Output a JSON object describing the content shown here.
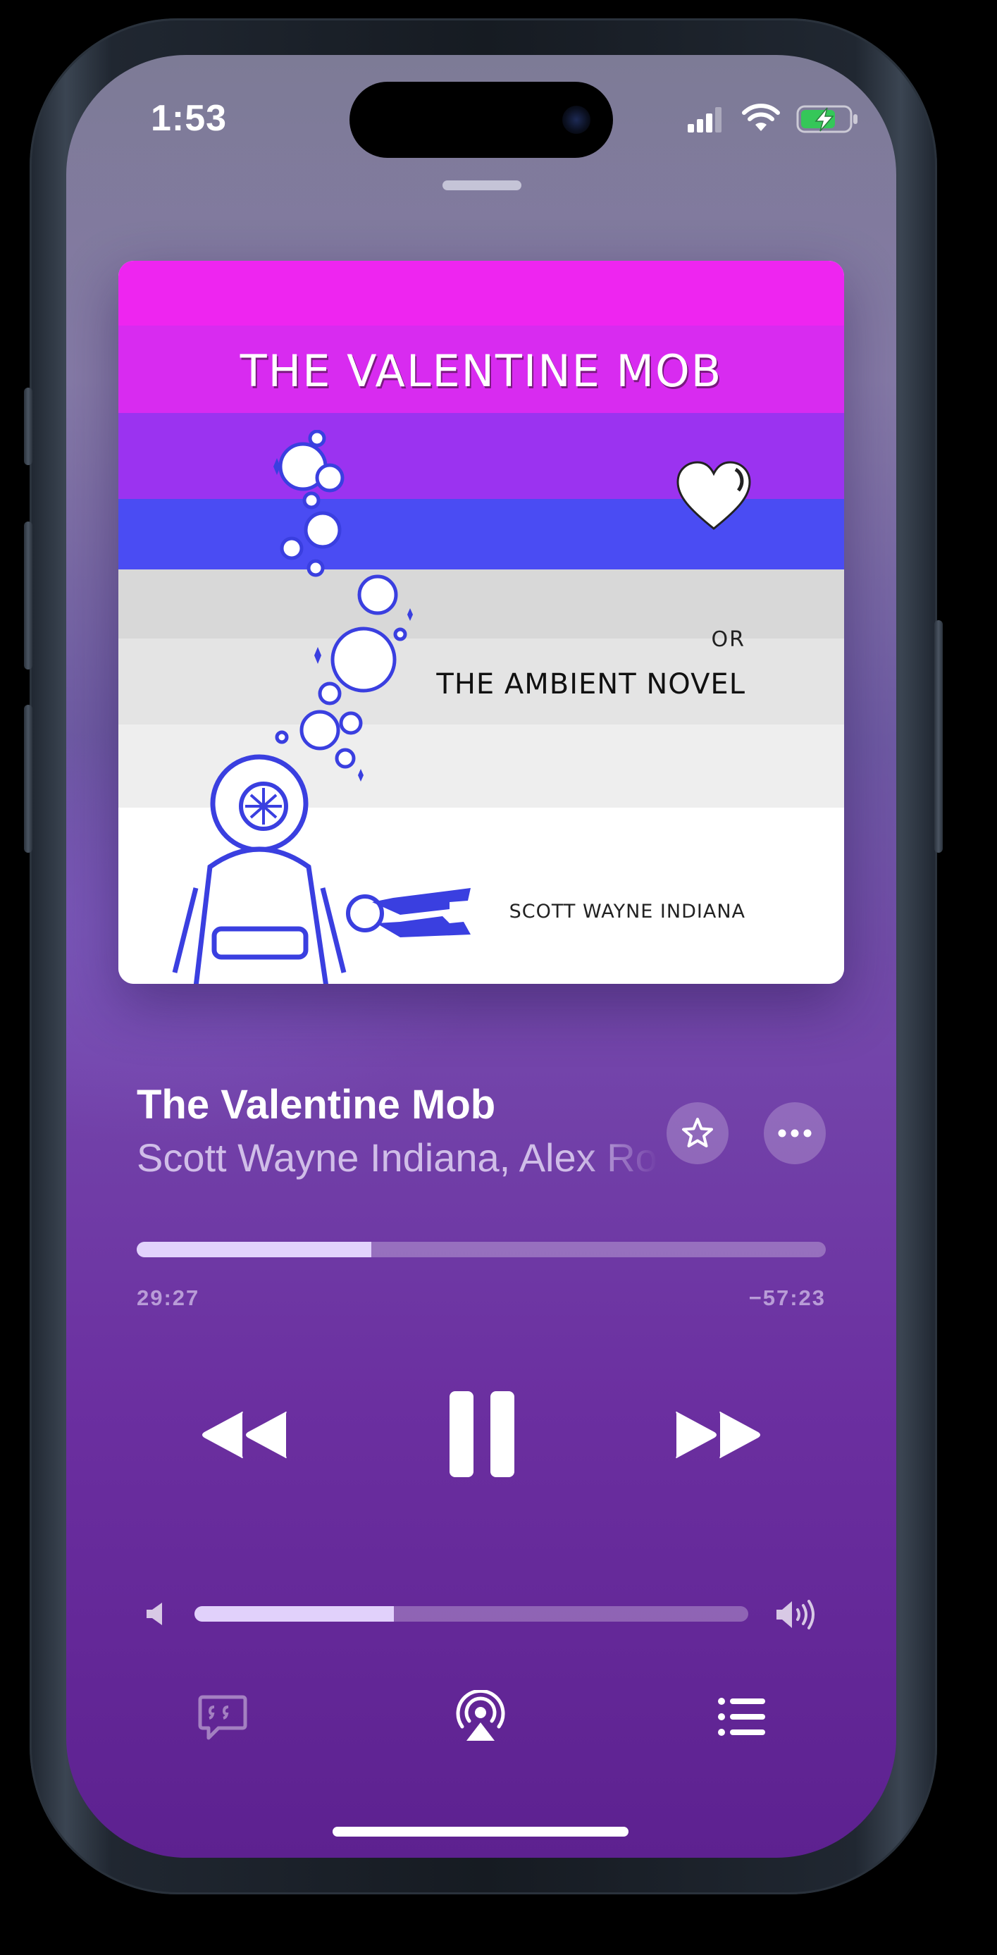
{
  "status_bar": {
    "time": "1:53"
  },
  "artwork": {
    "title": "THE VALENTINE MOB",
    "or": "OR",
    "subtitle": "THE AMBIENT NOVEL",
    "author": "SCOTT WAYNE INDIANA"
  },
  "now_playing": {
    "title": "The Valentine Mob",
    "artists": "Scott Wayne Indiana, Alex Rowe",
    "favorite_icon": "star-icon",
    "more_icon": "ellipsis-icon"
  },
  "progress": {
    "elapsed": "29:27",
    "remaining": "−57:23",
    "fraction": 0.34
  },
  "volume": {
    "fraction": 0.36
  },
  "controls": {
    "rewind_icon": "backward-icon",
    "play_pause_icon": "pause-icon",
    "forward_icon": "forward-icon"
  },
  "bottom_bar": {
    "lyrics_icon": "quote-bubble-icon",
    "airplay_icon": "airplay-audio-icon",
    "queue_icon": "list-icon"
  },
  "colors": {
    "art_band_1": "#ee25f0",
    "art_band_2": "#d82bf0",
    "art_band_3": "#9b33f0",
    "art_band_4": "#4a4cf3",
    "diver_blue": "#3a3fe0"
  }
}
